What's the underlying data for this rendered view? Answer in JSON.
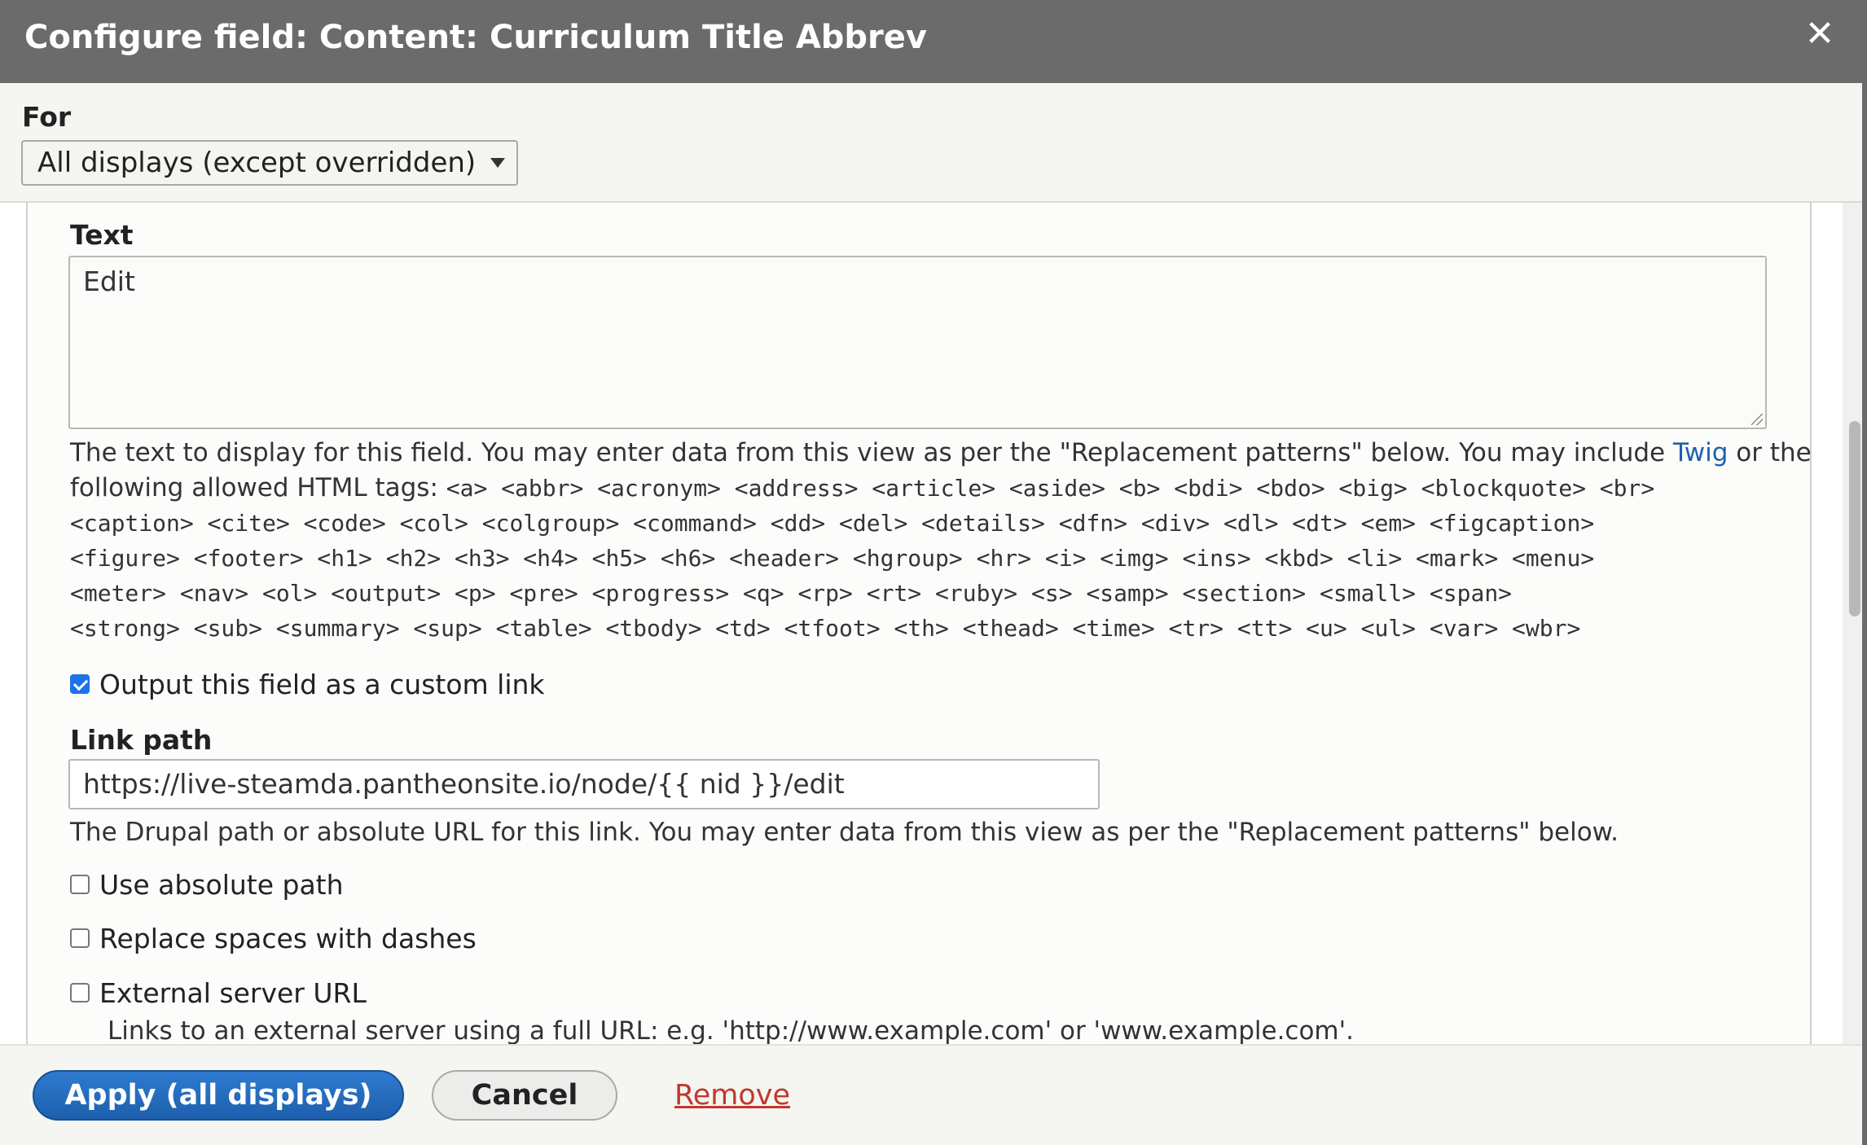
{
  "dialog": {
    "title": "Configure field: Content: Curriculum Title Abbrev",
    "close_glyph": "✕"
  },
  "for_section": {
    "label": "For",
    "selected": "All displays (except overridden)"
  },
  "text_field": {
    "label": "Text",
    "value": "Edit",
    "description_prefix": "The text to display for this field. You may enter data from this view as per the \"Replacement patterns\" below. You may include ",
    "twig_link": "Twig",
    "description_suffix": " or the",
    "allowed_tags_intro": "following allowed HTML tags: ",
    "allowed_tags_lines": [
      "<a> <abbr> <acronym> <address> <article> <aside> <b> <bdi> <bdo> <big> <blockquote> <br>",
      "<caption> <cite> <code> <col> <colgroup> <command> <dd> <del> <details> <dfn> <div> <dl> <dt> <em> <figcaption>",
      "<figure> <footer> <h1> <h2> <h3> <h4> <h5> <h6> <header> <hgroup> <hr> <i> <img> <ins> <kbd> <li> <mark> <menu>",
      "<meter> <nav> <ol> <output> <p> <pre> <progress> <q> <rp> <rt> <ruby> <s> <samp> <section> <small> <span>",
      "<strong> <sub> <summary> <sup> <table> <tbody> <td> <tfoot> <th> <thead> <time> <tr> <tt> <u> <ul> <var> <wbr>"
    ]
  },
  "custom_link": {
    "label": "Output this field as a custom link",
    "checked": true
  },
  "link_path": {
    "label": "Link path",
    "value": "https://live-steamda.pantheonsite.io/node/{{ nid }}/edit",
    "description": "The Drupal path or absolute URL for this link. You may enter data from this view as per the \"Replacement patterns\" below."
  },
  "options": [
    {
      "label": "Use absolute path",
      "checked": false
    },
    {
      "label": "Replace spaces with dashes",
      "checked": false
    },
    {
      "label": "External server URL",
      "checked": false
    }
  ],
  "external_description": "Links to an external server using a full URL: e.g. 'http://www.example.com' or 'www.example.com'.",
  "footer": {
    "apply_label": "Apply (all displays)",
    "cancel_label": "Cancel",
    "remove_label": "Remove"
  },
  "colors": {
    "titlebar": "#6b6b6b",
    "primary": "#1d5fad",
    "link": "#1e5fae",
    "danger": "#c0392b",
    "checkbox": "#1a73e8"
  }
}
